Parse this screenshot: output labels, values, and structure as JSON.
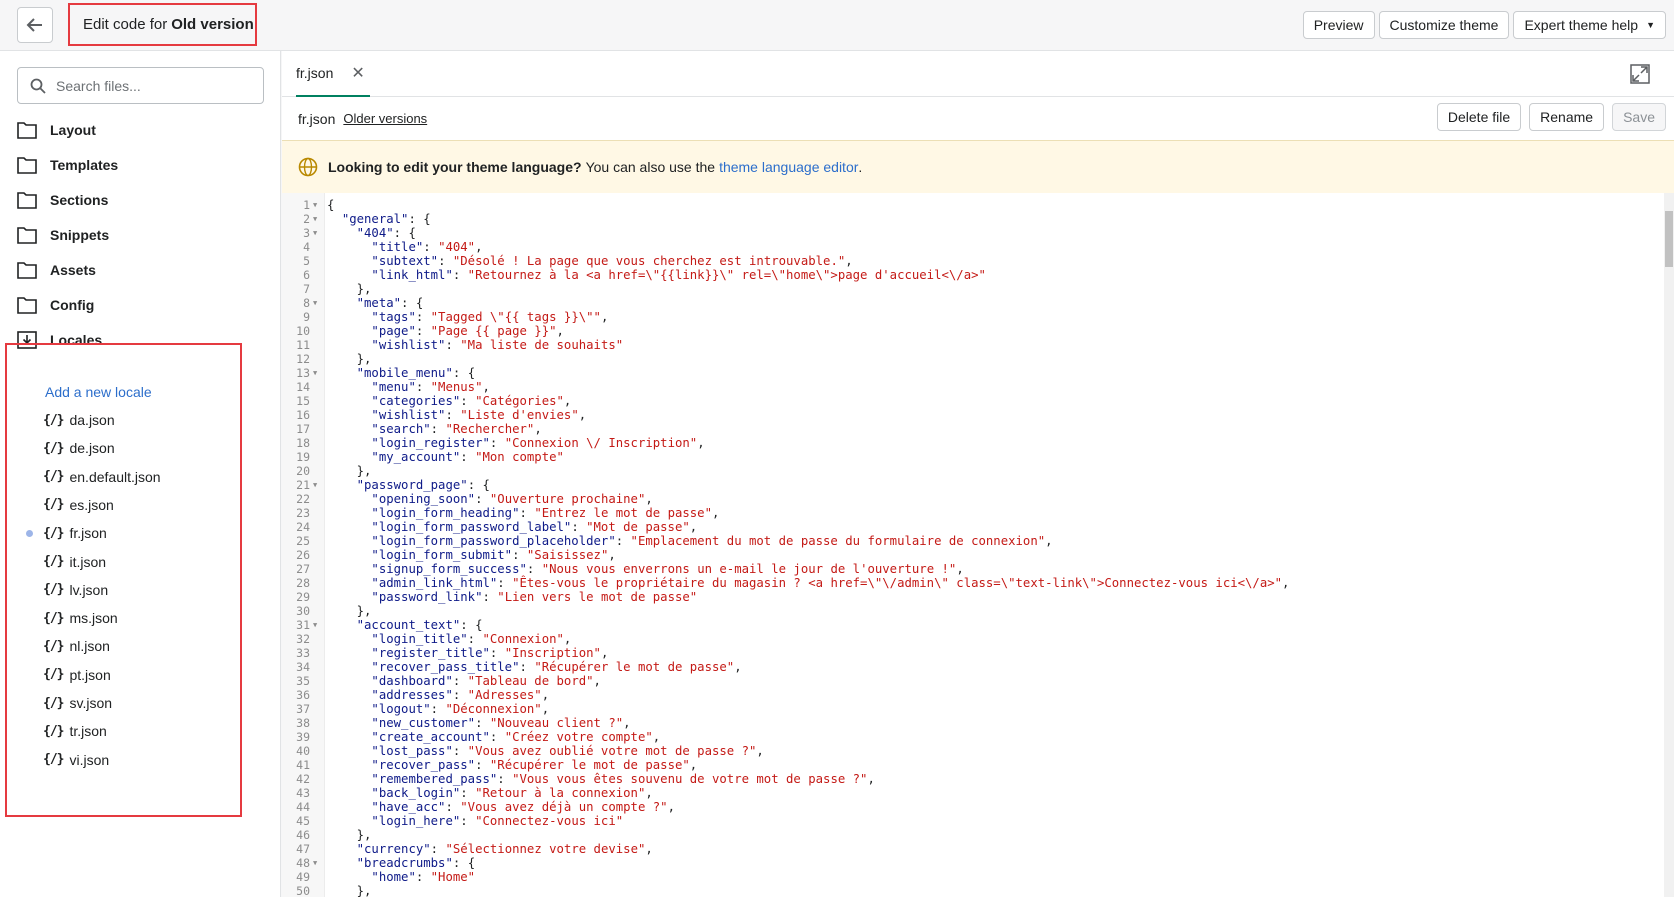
{
  "header": {
    "title_prefix": "Edit code for",
    "theme_name": "Old version",
    "buttons": {
      "preview": "Preview",
      "customize": "Customize theme",
      "expert": "Expert theme help"
    }
  },
  "sidebar": {
    "search_placeholder": "Search files...",
    "folders": [
      "Layout",
      "Templates",
      "Sections",
      "Snippets",
      "Assets",
      "Config",
      "Locales"
    ],
    "add_locale": "Add a new locale",
    "locale_files": [
      "da.json",
      "de.json",
      "en.default.json",
      "es.json",
      "fr.json",
      "it.json",
      "lv.json",
      "ms.json",
      "nl.json",
      "pt.json",
      "sv.json",
      "tr.json",
      "vi.json"
    ],
    "active_file": "fr.json"
  },
  "tab": {
    "label": "fr.json"
  },
  "filebar": {
    "name": "fr.json",
    "older_versions": "Older versions",
    "delete": "Delete file",
    "rename": "Rename",
    "save": "Save"
  },
  "banner": {
    "bold": "Looking to edit your theme language?",
    "text": "You can also use the",
    "link": "theme language editor",
    "end": "."
  },
  "colors": {
    "accent": "#008060",
    "highlight_border": "#e53a40",
    "link": "#2c6ecb",
    "string": "#c41a16",
    "key": "#0e1a88"
  },
  "code_lines": [
    "{",
    "  \"general\": {",
    "    \"404\": {",
    "      \"title\": \"404\",",
    "      \"subtext\": \"Désolé ! La page que vous cherchez est introuvable.\",",
    "      \"link_html\": \"Retournez à la <a href=\\\"{{link}}\\\" rel=\\\"home\\\">page d'accueil<\\/a>\"",
    "    },",
    "    \"meta\": {",
    "      \"tags\": \"Tagged \\\"{{ tags }}\\\"\",",
    "      \"page\": \"Page {{ page }}\",",
    "      \"wishlist\": \"Ma liste de souhaits\"",
    "    },",
    "    \"mobile_menu\": {",
    "      \"menu\": \"Menus\",",
    "      \"categories\": \"Catégories\",",
    "      \"wishlist\": \"Liste d'envies\",",
    "      \"search\": \"Rechercher\",",
    "      \"login_register\": \"Connexion \\/ Inscription\",",
    "      \"my_account\": \"Mon compte\"",
    "    },",
    "    \"password_page\": {",
    "      \"opening_soon\": \"Ouverture prochaine\",",
    "      \"login_form_heading\": \"Entrez le mot de passe\",",
    "      \"login_form_password_label\": \"Mot de passe\",",
    "      \"login_form_password_placeholder\": \"Emplacement du mot de passe du formulaire de connexion\",",
    "      \"login_form_submit\": \"Saisissez\",",
    "      \"signup_form_success\": \"Nous vous enverrons un e-mail le jour de l'ouverture !\",",
    "      \"admin_link_html\": \"Êtes-vous le propriétaire du magasin ? <a href=\\\"\\/admin\\\" class=\\\"text-link\\\">Connectez-vous ici<\\/a>\",",
    "      \"password_link\": \"Lien vers le mot de passe\"",
    "    },",
    "    \"account_text\": {",
    "      \"login_title\": \"Connexion\",",
    "      \"register_title\": \"Inscription\",",
    "      \"recover_pass_title\": \"Récupérer le mot de passe\",",
    "      \"dashboard\": \"Tableau de bord\",",
    "      \"addresses\": \"Adresses\",",
    "      \"logout\": \"Déconnexion\",",
    "      \"new_customer\": \"Nouveau client ?\",",
    "      \"create_account\": \"Créez votre compte\",",
    "      \"lost_pass\": \"Vous avez oublié votre mot de passe ?\",",
    "      \"recover_pass\": \"Récupérer le mot de passe\",",
    "      \"remembered_pass\": \"Vous vous êtes souvenu de votre mot de passe ?\",",
    "      \"back_login\": \"Retour à la connexion\",",
    "      \"have_acc\": \"Vous avez déjà un compte ?\",",
    "      \"login_here\": \"Connectez-vous ici\"",
    "    },",
    "    \"currency\": \"Sélectionnez votre devise\",",
    "    \"breadcrumbs\": {",
    "      \"home\": \"Home\"",
    "    },"
  ],
  "fold_lines": [
    1,
    2,
    3,
    8,
    13,
    21,
    31,
    48
  ]
}
